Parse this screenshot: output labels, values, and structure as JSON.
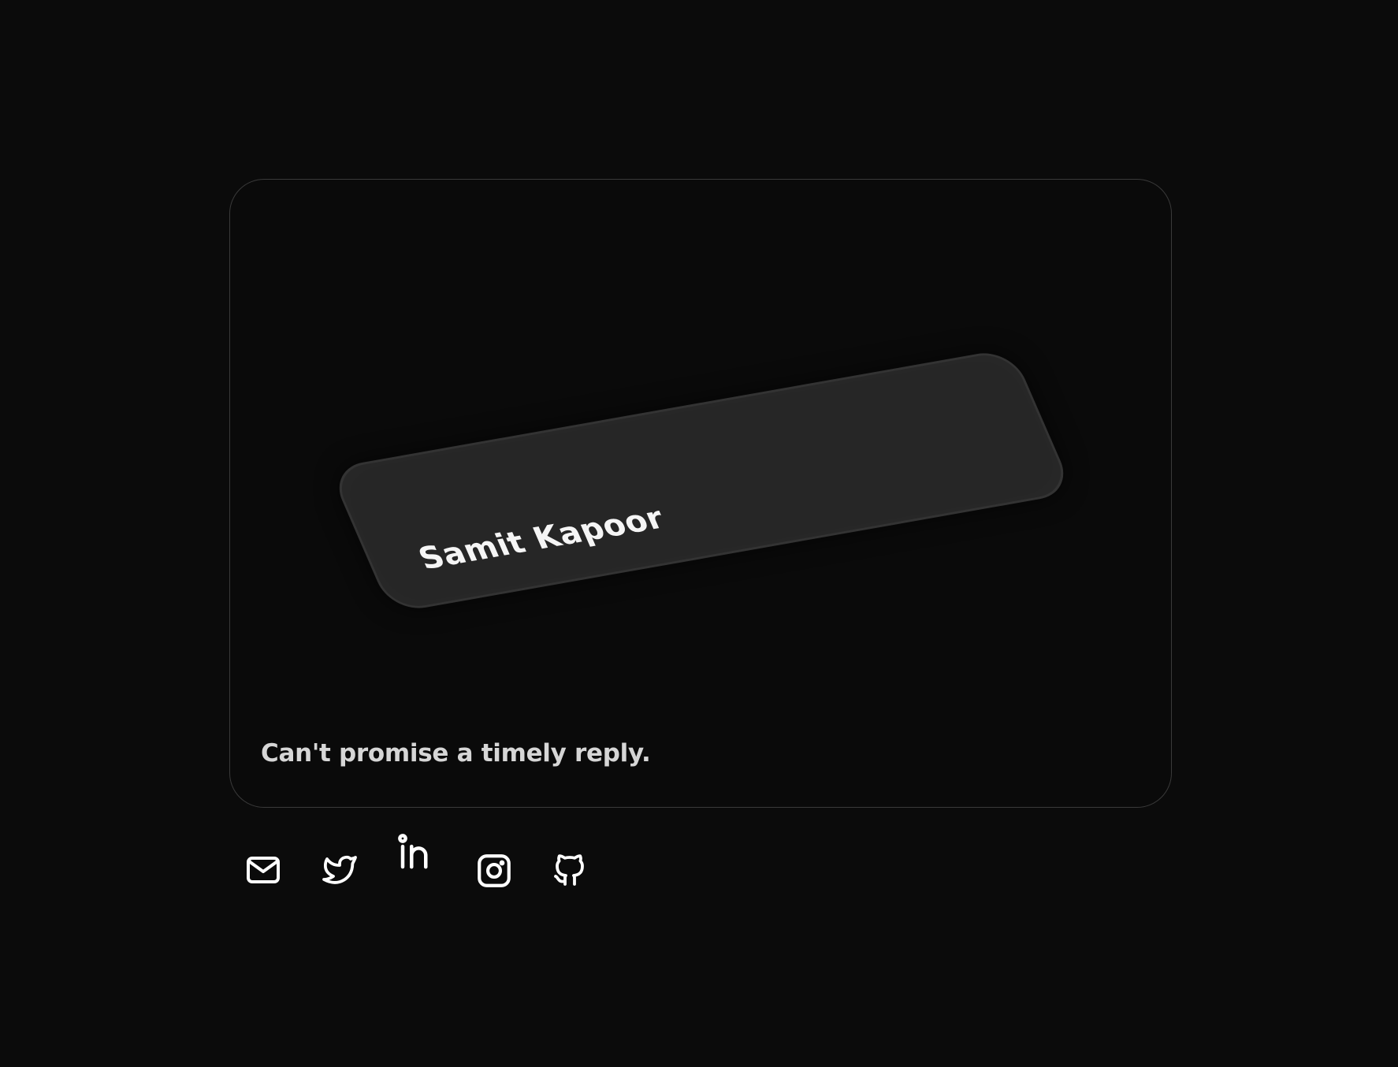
{
  "card": {
    "name": "Samit Kapoor"
  },
  "tagline": "Can't promise a timely reply.",
  "socials": [
    {
      "icon": "mail-icon"
    },
    {
      "icon": "twitter-icon"
    },
    {
      "icon": "linkedin-icon"
    },
    {
      "icon": "instagram-icon"
    },
    {
      "icon": "github-icon"
    }
  ],
  "colors": {
    "background": "#0b0b0b",
    "frame_border": "#3a3a3a",
    "card": "#262626",
    "name_text": "#f5f5f5",
    "tagline_text": "#d6d6d6",
    "icon": "#ffffff"
  }
}
